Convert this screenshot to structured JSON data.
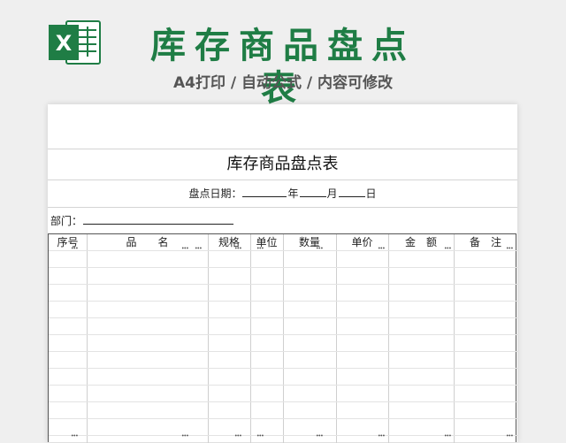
{
  "banner": {
    "title": "库存商品盘点表",
    "subtitle": "A4打印 / 自动公式 / 内容可修改",
    "logo_letter": "X",
    "brand_color": "#1f7d45"
  },
  "sheet": {
    "title": "库存商品盘点表",
    "date_label": "盘点日期：",
    "year_label": "年",
    "month_label": "月",
    "day_label": "日",
    "dept_label": "部门：",
    "columns": [
      "序号",
      "品　　名",
      "规格",
      "单位",
      "数量",
      "单价",
      "金　额",
      "备　注"
    ]
  }
}
